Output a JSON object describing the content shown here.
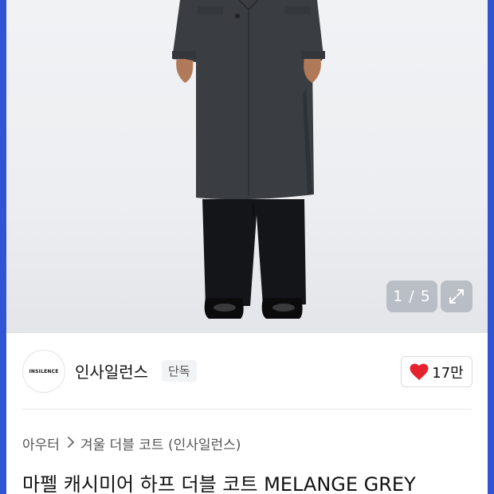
{
  "gallery": {
    "counter": "1 / 5",
    "image_alt": "model wearing charcoal double-breasted wool coat with black wide trousers and black loafers",
    "expand_icon": "expand-icon"
  },
  "brand": {
    "logo_text": "INSILENCE",
    "name": "인사일런스",
    "badge": "단독",
    "likes": "17만",
    "heart_color": "#e5222e"
  },
  "category": {
    "items": [
      "아우터",
      "겨울 더블 코트 (인사일런스)"
    ]
  },
  "product": {
    "title": "마펠 캐시미어 하프 더블 코트 MELANGE GREY"
  }
}
